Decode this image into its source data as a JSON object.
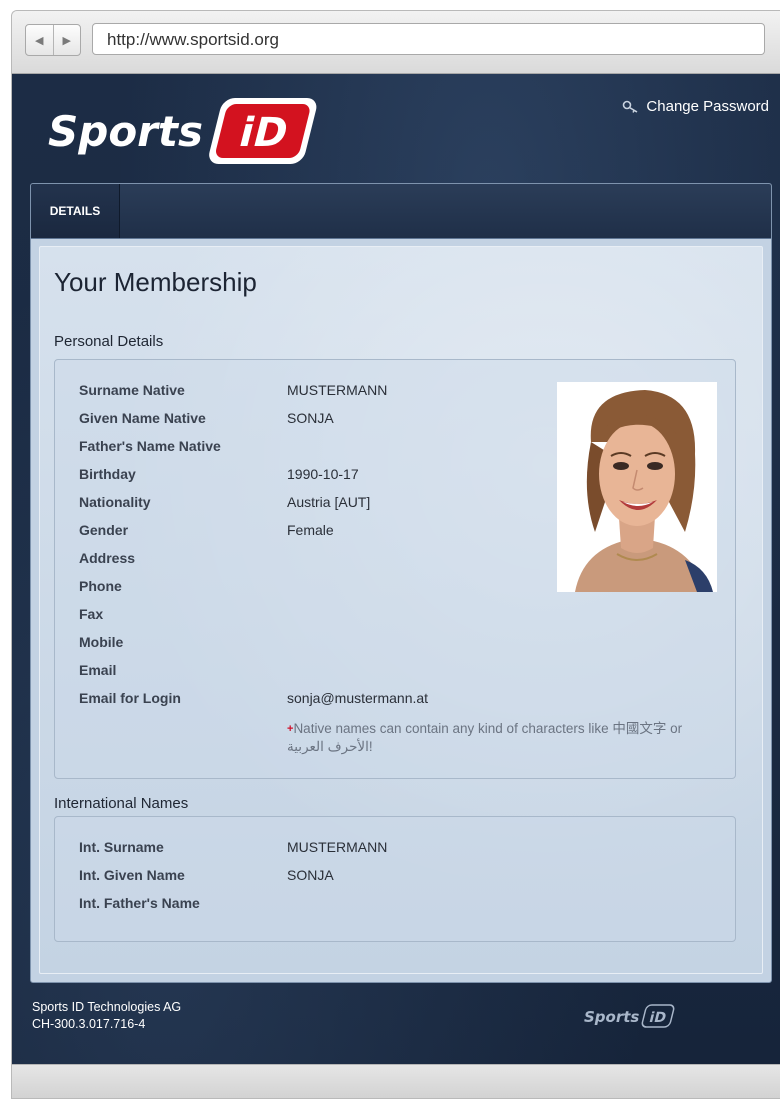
{
  "browser": {
    "url": "http://www.sportsid.org",
    "back_icon": "back-arrow-icon",
    "forward_icon": "forward-arrow-icon"
  },
  "header": {
    "logo_text": "Sports",
    "logo_badge": "iD",
    "change_password": "Change Password",
    "key_icon": "key-icon"
  },
  "tabs": [
    {
      "label": "DETAILS",
      "active": true
    }
  ],
  "page_title": "Your Membership",
  "personal": {
    "section_title": "Personal Details",
    "fields": [
      {
        "label": "Surname Native",
        "value": "MUSTERMANN"
      },
      {
        "label": "Given Name Native",
        "value": "SONJA"
      },
      {
        "label": "Father's Name Native",
        "value": ""
      },
      {
        "label": "Birthday",
        "value": "1990-10-17"
      },
      {
        "label": "Nationality",
        "value": "Austria [AUT]"
      },
      {
        "label": "Gender",
        "value": "Female"
      },
      {
        "label": "Address",
        "value": ""
      },
      {
        "label": "Phone",
        "value": ""
      },
      {
        "label": "Fax",
        "value": ""
      },
      {
        "label": "Mobile",
        "value": ""
      },
      {
        "label": "Email",
        "value": ""
      },
      {
        "label": "Email for Login",
        "value": "sonja@mustermann.at"
      }
    ],
    "note_star": "+",
    "note": "Native names can contain any kind of characters like 中國文字 or الأحرف العربية!"
  },
  "international": {
    "section_title": "International Names",
    "fields": [
      {
        "label": "Int. Surname",
        "value": "MUSTERMANN"
      },
      {
        "label": "Int. Given Name",
        "value": "SONJA"
      },
      {
        "label": "Int. Father's Name",
        "value": ""
      }
    ]
  },
  "footer": {
    "company": "Sports ID Technologies AG",
    "registration": "CH-300.3.017.716-4",
    "logo_text": "Sports",
    "logo_badge": "iD"
  },
  "colors": {
    "brand_red": "#d3121f",
    "header_bg": "#1c2c45",
    "content_bg": "#c9d7e6"
  }
}
